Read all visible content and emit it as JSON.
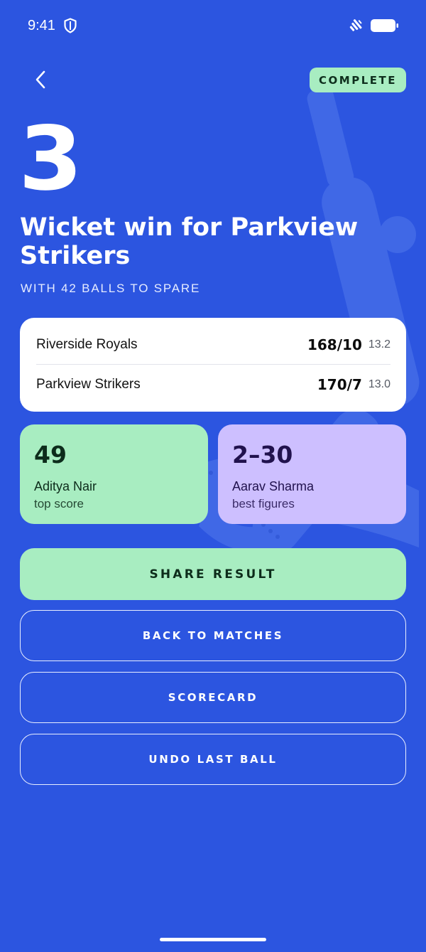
{
  "status_bar": {
    "time": "9:41"
  },
  "header": {
    "status_label": "COMPLETE"
  },
  "result": {
    "margin": "3",
    "title": "Wicket win for Parkview Strikers",
    "subtitle": "WITH 42 BALLS TO SPARE"
  },
  "scorecard": {
    "rows": [
      {
        "team": "Riverside Royals",
        "score": "168/10",
        "overs": "13.2"
      },
      {
        "team": "Parkview Strikers",
        "score": "170/7",
        "overs": "13.0"
      }
    ]
  },
  "stats": [
    {
      "value": "49",
      "player": "Aditya Nair",
      "caption": "top score"
    },
    {
      "value": "2–30",
      "player": "Aarav Sharma",
      "caption": "best figures"
    }
  ],
  "actions": {
    "share": "SHARE RESULT",
    "back_to_matches": "BACK TO MATCHES",
    "scorecard": "SCORECARD",
    "undo": "UNDO LAST BALL"
  },
  "colors": {
    "background": "#2c55e0",
    "mint": "#a8edc1",
    "lavender": "#cdbfff",
    "card": "#ffffff"
  },
  "icons": [
    "shield-icon",
    "wifi-icon",
    "battery-icon",
    "back-chevron-icon",
    "cricket-bat-icon"
  ]
}
